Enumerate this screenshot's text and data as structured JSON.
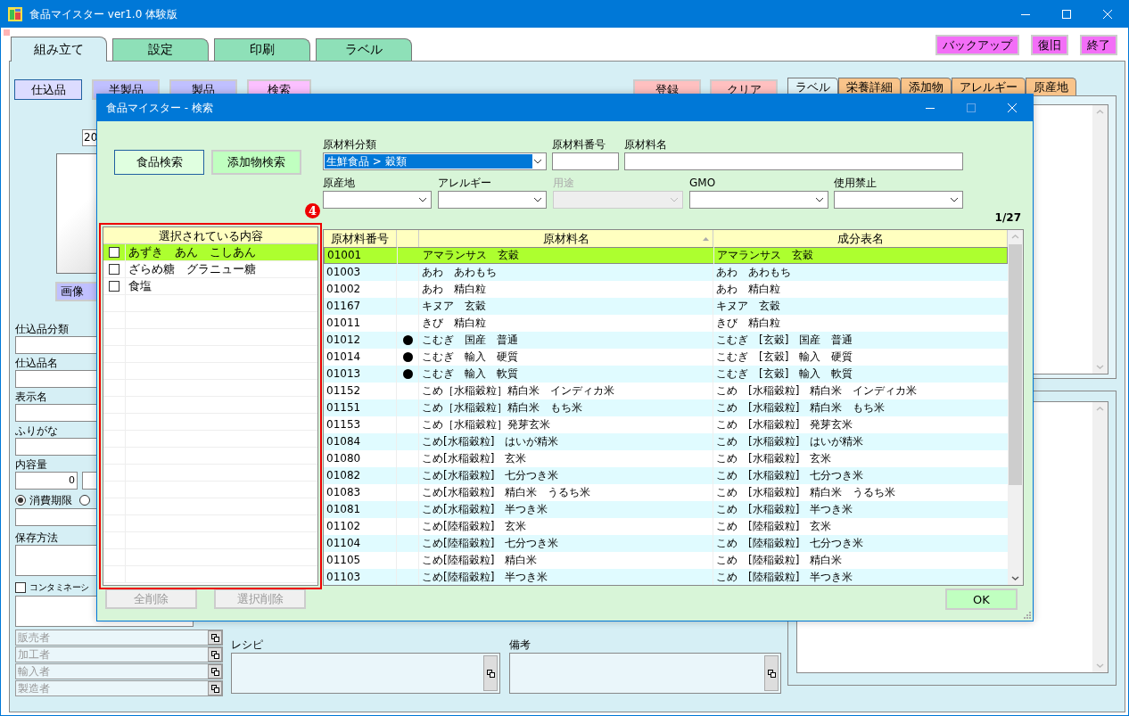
{
  "window": {
    "title": "食品マイスター ver1.0 体験版"
  },
  "main_tabs": [
    {
      "label": "組み立て",
      "selected": true
    },
    {
      "label": "設定",
      "selected": false
    },
    {
      "label": "印刷",
      "selected": false
    },
    {
      "label": "ラベル",
      "selected": false
    }
  ],
  "top_buttons": [
    "バックアップ",
    "復旧",
    "終了"
  ],
  "type_buttons": [
    {
      "label": "仕込品",
      "selected": true
    },
    {
      "label": "半製品",
      "selected": false
    },
    {
      "label": "製品",
      "selected": false
    }
  ],
  "search_button": "検索",
  "action_buttons": [
    "登録",
    "クリア"
  ],
  "form": {
    "date_field": "20",
    "image_button": "画像",
    "fields": [
      {
        "label": "仕込品分類"
      },
      {
        "label": "仕込品名"
      },
      {
        "label": "表示名"
      },
      {
        "label": "ふりがな"
      }
    ],
    "quantity": {
      "label": "内容量",
      "value": "0"
    },
    "expiry_options": [
      {
        "label": "消費期限",
        "selected": true
      },
      {
        "selected": false
      }
    ],
    "storage_label": "保存方法",
    "contamination": {
      "label": "コンタミネーシ",
      "checked": false
    }
  },
  "parties": [
    "販売者",
    "加工者",
    "輸入者",
    "製造者"
  ],
  "recipe_label": "レシピ",
  "notes_label": "備考",
  "label_tabs": [
    {
      "label": "ラベル",
      "selected": true
    },
    {
      "label": "栄養詳細",
      "selected": false
    },
    {
      "label": "添加物",
      "selected": false
    },
    {
      "label": "アレルギー",
      "selected": false
    },
    {
      "label": "原産地",
      "selected": false
    }
  ],
  "dialog": {
    "title": "食品マイスター - 検索",
    "mode_buttons": [
      {
        "label": "食品検索",
        "selected": true
      },
      {
        "label": "添加物検索",
        "selected": false
      }
    ],
    "filters_row1": [
      {
        "label": "原材料分類",
        "kind": "select",
        "value": "生鮮食品 > 穀類",
        "disabled": false
      },
      {
        "label": "原材料番号",
        "kind": "input",
        "disabled": false
      },
      {
        "label": "原材料名",
        "kind": "input",
        "disabled": false
      }
    ],
    "filters_row2": [
      {
        "label": "原産地",
        "kind": "select",
        "disabled": false
      },
      {
        "label": "アレルギー",
        "kind": "select",
        "disabled": false
      },
      {
        "label": "用途",
        "kind": "select",
        "disabled": true
      },
      {
        "label": "GMO",
        "kind": "select",
        "disabled": false
      },
      {
        "label": "使用禁止",
        "kind": "select",
        "disabled": false
      }
    ],
    "annotation_marker": "4",
    "selected_list": {
      "header": "選択されている内容",
      "items": [
        {
          "name": "あずき　あん　こしあん",
          "checked": false,
          "selected": true
        },
        {
          "name": "ざらめ糖　グラニュー糖",
          "checked": false,
          "selected": false
        },
        {
          "name": "食塩",
          "checked": false,
          "selected": false
        }
      ]
    },
    "delete_buttons": [
      {
        "label": "全削除",
        "disabled": true
      },
      {
        "label": "選択削除",
        "disabled": true
      }
    ],
    "page_count": "1/27",
    "table": {
      "columns": [
        "原材料番号",
        "原材料名",
        "成分表名"
      ],
      "rows": [
        {
          "code": "01001",
          "flagged": false,
          "name": "アマランサス　玄穀",
          "table_name": "アマランサス　玄穀",
          "selected": true
        },
        {
          "code": "01003",
          "flagged": false,
          "name": "あわ　あわもち",
          "table_name": "あわ　あわもち",
          "selected": false
        },
        {
          "code": "01002",
          "flagged": false,
          "name": "あわ　精白粒",
          "table_name": "あわ　精白粒",
          "selected": false
        },
        {
          "code": "01167",
          "flagged": false,
          "name": "キヌア　玄穀",
          "table_name": "キヌア　玄穀",
          "selected": false
        },
        {
          "code": "01011",
          "flagged": false,
          "name": "きび　精白粒",
          "table_name": "きび　精白粒",
          "selected": false
        },
        {
          "code": "01012",
          "flagged": true,
          "name": "こむぎ　国産　普通",
          "table_name": "こむぎ　[玄穀]　国産　普通",
          "selected": false
        },
        {
          "code": "01014",
          "flagged": true,
          "name": "こむぎ　輸入　硬質",
          "table_name": "こむぎ　[玄穀]　輸入　硬質",
          "selected": false
        },
        {
          "code": "01013",
          "flagged": true,
          "name": "こむぎ　輸入　軟質",
          "table_name": "こむぎ　[玄穀]　輸入　軟質",
          "selected": false
        },
        {
          "code": "01152",
          "flagged": false,
          "name": "こめ［水稲穀粒］精白米　インディカ米",
          "table_name": "こめ　[水稲穀粒]　精白米　インディカ米",
          "selected": false
        },
        {
          "code": "01151",
          "flagged": false,
          "name": "こめ［水稲穀粒］精白米　もち米",
          "table_name": "こめ　[水稲穀粒]　精白米　もち米",
          "selected": false
        },
        {
          "code": "01153",
          "flagged": false,
          "name": "こめ［水稲穀粒］発芽玄米",
          "table_name": "こめ　[水稲穀粒]　発芽玄米",
          "selected": false
        },
        {
          "code": "01084",
          "flagged": false,
          "name": "こめ[水稲穀粒]　はいが精米",
          "table_name": "こめ　[水稲穀粒]　はいが精米",
          "selected": false
        },
        {
          "code": "01080",
          "flagged": false,
          "name": "こめ[水稲穀粒]　玄米",
          "table_name": "こめ　[水稲穀粒]　玄米",
          "selected": false
        },
        {
          "code": "01082",
          "flagged": false,
          "name": "こめ[水稲穀粒]　七分つき米",
          "table_name": "こめ　[水稲穀粒]　七分つき米",
          "selected": false
        },
        {
          "code": "01083",
          "flagged": false,
          "name": "こめ[水稲穀粒]　精白米　うるち米",
          "table_name": "こめ　[水稲穀粒]　精白米　うるち米",
          "selected": false
        },
        {
          "code": "01081",
          "flagged": false,
          "name": "こめ[水稲穀粒]　半つき米",
          "table_name": "こめ　[水稲穀粒]　半つき米",
          "selected": false
        },
        {
          "code": "01102",
          "flagged": false,
          "name": "こめ[陸稲穀粒]　玄米",
          "table_name": "こめ　[陸稲穀粒]　玄米",
          "selected": false
        },
        {
          "code": "01104",
          "flagged": false,
          "name": "こめ[陸稲穀粒]　七分つき米",
          "table_name": "こめ　[陸稲穀粒]　七分つき米",
          "selected": false
        },
        {
          "code": "01105",
          "flagged": false,
          "name": "こめ[陸稲穀粒]　精白米",
          "table_name": "こめ　[陸稲穀粒]　精白米",
          "selected": false
        },
        {
          "code": "01103",
          "flagged": false,
          "name": "こめ[陸稲穀粒]　半つき米",
          "table_name": "こめ　[陸稲穀粒]　半つき米",
          "selected": false
        }
      ]
    },
    "ok_button": "OK"
  }
}
